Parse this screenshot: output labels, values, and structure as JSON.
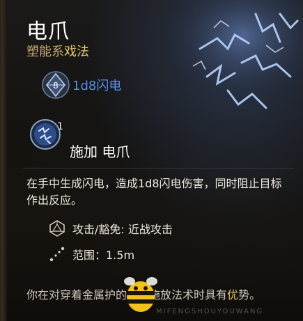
{
  "spell": {
    "name": "电爪",
    "school": "塑能系",
    "category": "戏法"
  },
  "dice": {
    "icon": "d8-dice-icon",
    "face": "8",
    "label": "1d8闪电"
  },
  "action": {
    "icon": "lightning-hand-icon",
    "count": "1",
    "label": "施加 电爪"
  },
  "description": "在手中生成闪电，造成1d8闪电伤害，同时阻止目标作出反应。",
  "properties": [
    {
      "icon": "d20-dice-icon",
      "text": "攻击/豁免: 近战攻击"
    },
    {
      "icon": "range-dotted-line-icon",
      "text": "范围：1.5m"
    }
  ],
  "footer": {
    "text_before": "你在对穿着金属护",
    "text_middle": "的生物",
    "text_after": "施放法术时具有",
    "accent": "优",
    "text_end": "势。"
  },
  "watermark": {
    "logo": "bee-logo",
    "text": "MIFENGSHOUYOUWANG"
  },
  "colors": {
    "title": "#ffffff",
    "school": "#c9a96a",
    "accent": "#e7c66b",
    "damage": "#5a8ee8"
  }
}
